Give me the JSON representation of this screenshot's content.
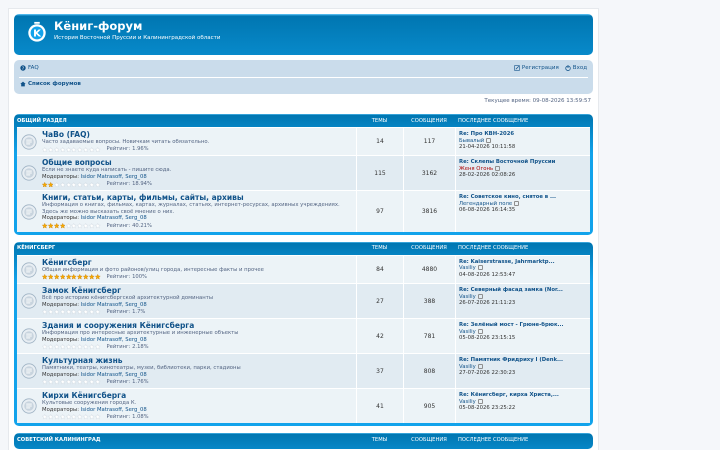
{
  "site": {
    "title": "Кёниг-форум",
    "description": "История Восточной Пруссии и Калининградской области"
  },
  "nav": {
    "faq": "FAQ",
    "register": "Регистрация",
    "login": "Вход",
    "breadcrumb": "Список форумов"
  },
  "current_time": "Текущее время: 09-08-2026 13:59:57",
  "columns": {
    "topics": "ТЕМЫ",
    "posts": "СООБЩЕНИЯ",
    "last": "ПОСЛЕДНЕЕ СООБЩЕНИЕ"
  },
  "moderators_label": "Модераторы:",
  "colors": {
    "header": "#12A3EB",
    "link": "#105289",
    "row": "#ecf3f7",
    "row_alt": "#e1ebf2",
    "star": "#f7a800"
  },
  "categories": [
    {
      "name": "ОБЩИЙ РАЗДЕЛ",
      "forums": [
        {
          "title": "ЧаВо (FAQ)",
          "desc": "Часто задаваемые вопросы. Новичкам читать обязательно.",
          "mods": "",
          "stars": 0,
          "rating": "Рейтинг: 1.96%",
          "topics": "14",
          "posts": "117",
          "last_title": "Re: Про КВН-2026",
          "last_author": "Бывалый",
          "last_red": false,
          "last_date": "21-04-2026 10:11:58"
        },
        {
          "title": "Общие вопросы",
          "desc": "Если не знаете куда написать - пишите сюда.",
          "mods": "Isidor Matrasoff, Serg_08",
          "stars": 2,
          "rating": "Рейтинг: 18.94%",
          "topics": "115",
          "posts": "3162",
          "last_title": "Re: Склепы Восточной Пруссии",
          "last_author": "Женя Огонь",
          "last_red": true,
          "last_date": "28-02-2026 02:08:26"
        },
        {
          "title": "Книги, статьи, карты, фильмы, сайты, архивы",
          "desc": "Информация о книгах, фильмах, картах, журналах, статьях, интернет-ресурсах, архивных учреждениях. Здесь же можно высказать своё мнение о них.",
          "mods": "Isidor Matrasoff, Serg_08",
          "stars": 4,
          "rating": "Рейтинг: 40.21%",
          "topics": "97",
          "posts": "3816",
          "last_title": "Re: Советское кино, снятое в ...",
          "last_author": "Легендарный поле",
          "last_red": false,
          "last_date": "06-08-2026 16:14:35"
        }
      ]
    },
    {
      "name": "КЁНИГСБЕРГ",
      "forums": [
        {
          "title": "Кёнигсберг",
          "desc": "Общая информация и фото районов/улиц города, интересные факты и прочее",
          "mods": "",
          "stars": 10,
          "rating": "Рейтинг: 100%",
          "topics": "84",
          "posts": "4880",
          "last_title": "Re: Kaiserstrasse, Jahrmarktp...",
          "last_author": "Vasiliy",
          "last_red": false,
          "last_date": "04-08-2026 12:53:47"
        },
        {
          "title": "Замок Кёнигсберг",
          "desc": "Всё про историю кёнигсбергской архитектурной доминанты",
          "mods": "Isidor Matrasoff, Serg_08",
          "stars": 0,
          "rating": "Рейтинг: 1.7%",
          "topics": "27",
          "posts": "388",
          "last_title": "Re: Северный фасад замка (Nor...",
          "last_author": "Vasiliy",
          "last_red": false,
          "last_date": "26-07-2026 21:11:23"
        },
        {
          "title": "Здания и сооружения Кёнигсберга",
          "desc": "Информация про интересные архитектурные и инженерные объекты",
          "mods": "Isidor Matrasoff, Serg_08",
          "stars": 0,
          "rating": "Рейтинг: 2.18%",
          "topics": "42",
          "posts": "781",
          "last_title": "Re: Зелёный мост - Грюне-брюк...",
          "last_author": "Vasiliy",
          "last_red": false,
          "last_date": "05-08-2026 23:15:15"
        },
        {
          "title": "Культурная жизнь",
          "desc": "Памятники, театры, кинотеатры, музеи, библиотеки, парки, стадионы",
          "mods": "Isidor Matrasoff, Serg_08",
          "stars": 0,
          "rating": "Рейтинг: 1.76%",
          "topics": "37",
          "posts": "808",
          "last_title": "Re: Памятник Фридриху I (Denk...",
          "last_author": "Vasiliy",
          "last_red": false,
          "last_date": "27-07-2026 22:30:23"
        },
        {
          "title": "Кирхи Кёнигсберга",
          "desc": "Культовые сооружения города К.",
          "mods": "Isidor Matrasoff, Serg_08",
          "stars": 0,
          "rating": "Рейтинг: 1.08%",
          "topics": "41",
          "posts": "905",
          "last_title": "Re: Кёнигсберг, кирха Христа,...",
          "last_author": "Vasiliy",
          "last_red": false,
          "last_date": "05-08-2026 23:25:22"
        }
      ]
    },
    {
      "name": "СОВЕТСКИЙ КАЛИНИНГРАД",
      "forums": []
    }
  ]
}
